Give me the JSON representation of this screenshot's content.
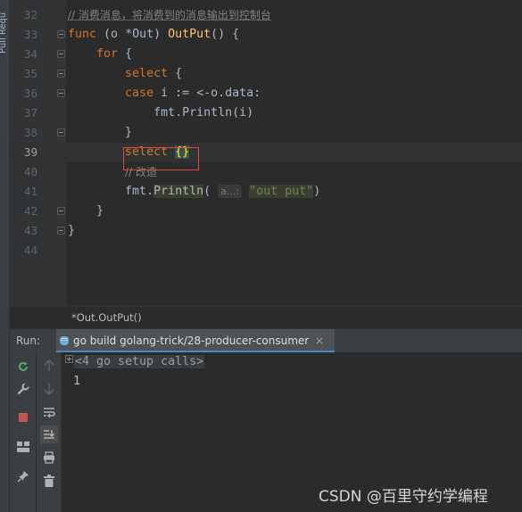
{
  "sidebar": {
    "vertical_tab": "Pull Requ"
  },
  "editor": {
    "lines": [
      {
        "num": "32",
        "comment": "// 消费消息，将消费到的消息输出到控制台"
      },
      {
        "num": "33",
        "func_kw": "func",
        "recv_open": " (",
        "recv_name": "o",
        "recv_type": " *Out",
        "recv_close": ") ",
        "fn_name": "OutPut",
        "fn_tail": "() {"
      },
      {
        "num": "34",
        "for_kw": "for",
        "tail": " {"
      },
      {
        "num": "35",
        "select_kw": "select",
        "tail": " {"
      },
      {
        "num": "36",
        "case_kw": "case",
        "body": " i := <-o.data:"
      },
      {
        "num": "37",
        "pkg": "fmt",
        "dot": ".",
        "call": "Println",
        "args": "(i)"
      },
      {
        "num": "38",
        "text": "}"
      },
      {
        "num": "39",
        "select_kw": "select",
        "brace": "{}"
      },
      {
        "num": "40",
        "comment": "// 改造"
      },
      {
        "num": "41",
        "pkg": "fmt",
        "dot": ".",
        "call": "Println",
        "open": "(",
        "hint": "a...:",
        "str": "\"out put\"",
        "close": ")"
      },
      {
        "num": "42",
        "text": "}"
      },
      {
        "num": "43",
        "text": "}"
      },
      {
        "num": "44",
        "text": ""
      }
    ],
    "current_line": "39"
  },
  "breadcrumb": {
    "text": "*Out.OutPut()"
  },
  "run_panel": {
    "label": "Run:",
    "tab_label": "go build golang-trick/28-producer-consumer",
    "tab_close": "×",
    "console": {
      "folded": "<4 go setup calls>",
      "output": "1"
    }
  },
  "icons": {
    "toolbar_left": [
      "rerun-icon",
      "wrench-icon",
      "stop-icon",
      "layout-icon",
      "pin-icon"
    ],
    "toolbar_right": [
      "up-arrow-icon",
      "down-arrow-icon",
      "soft-wrap-icon",
      "scroll-to-end-icon",
      "print-icon",
      "trash-icon"
    ]
  },
  "colors": {
    "keyword": "#cc7832",
    "function": "#ffc66d",
    "string": "#6a8759",
    "comment": "#808080",
    "highlight_box": "#e04545",
    "run_icon": "#59a869",
    "stop_icon": "#c75450"
  },
  "watermark": "CSDN @百里守约学编程"
}
